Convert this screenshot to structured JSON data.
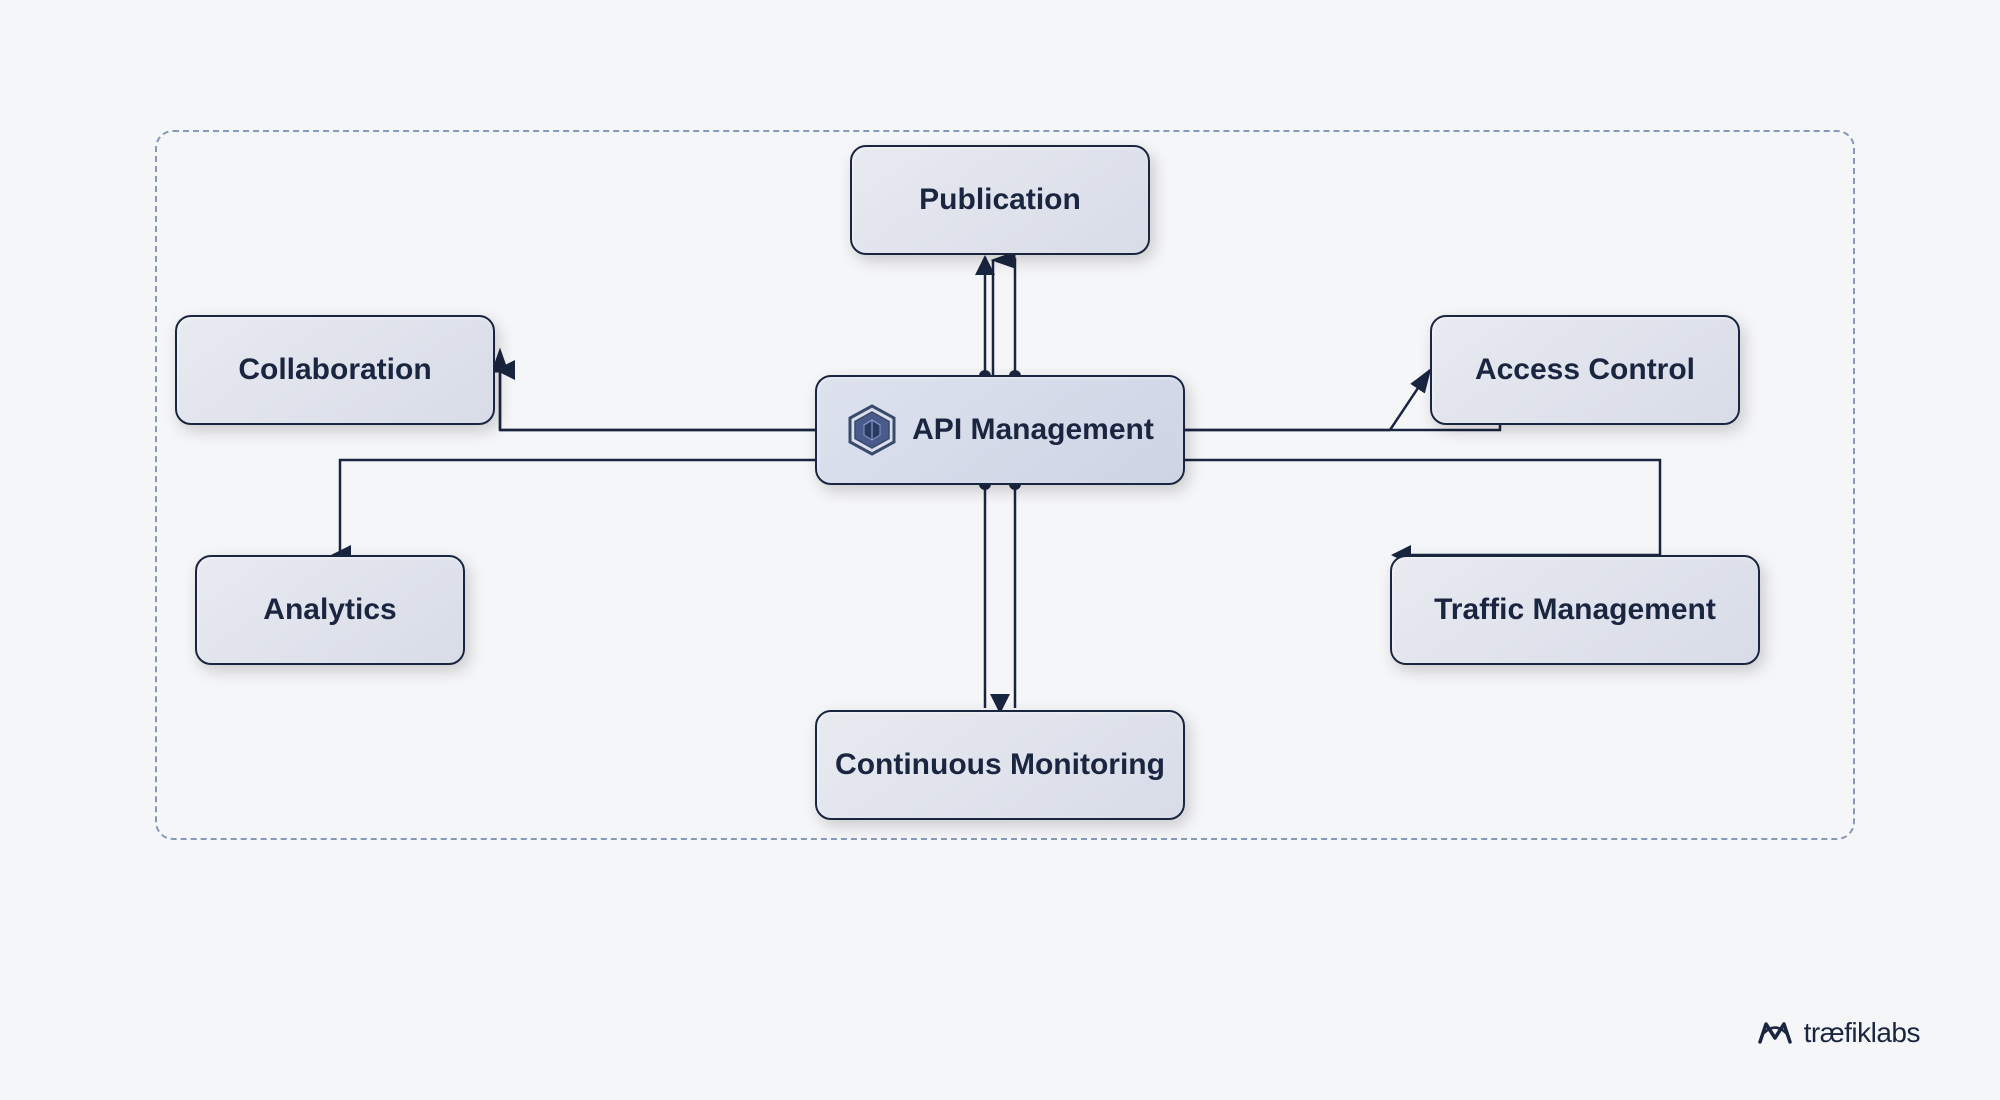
{
  "nodes": {
    "publication": {
      "label": "Publication"
    },
    "collaboration": {
      "label": "Collaboration"
    },
    "access_control": {
      "label": "Access Control"
    },
    "api_management": {
      "label": "API Management"
    },
    "analytics": {
      "label": "Analytics"
    },
    "traffic_management": {
      "label": "Traffic Management"
    },
    "continuous_monitoring": {
      "label": "Continuous Monitoring"
    }
  },
  "logo": {
    "text": "træfik",
    "suffix": "labs"
  }
}
